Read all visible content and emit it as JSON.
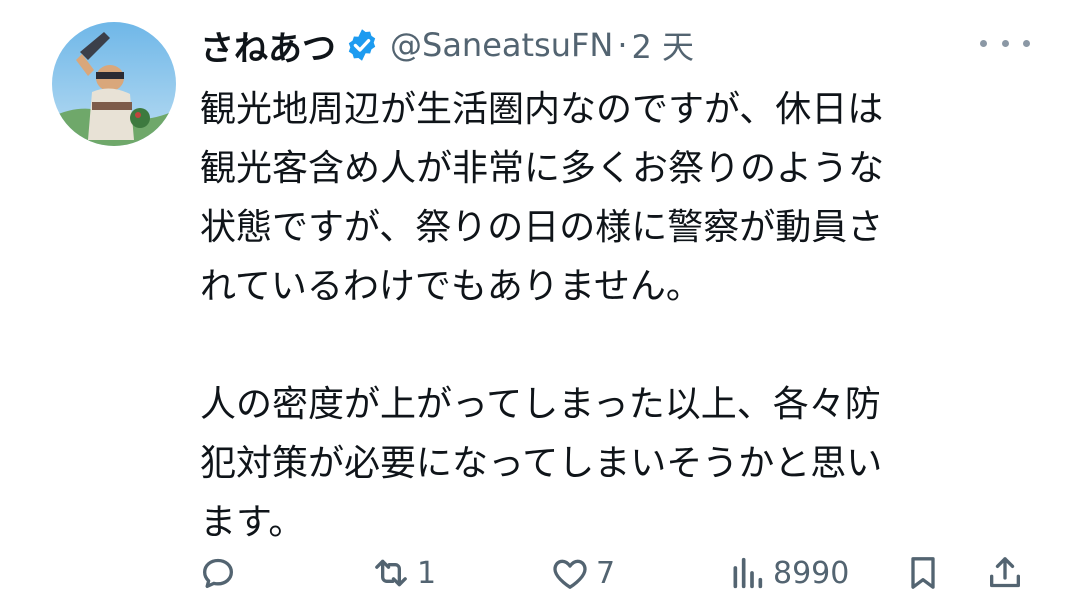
{
  "tweet": {
    "author": {
      "display_name": "さねあつ",
      "handle": "@SaneatsuFN",
      "verified": true
    },
    "separator": "·",
    "timestamp": "2 天",
    "paragraphs": [
      "観光地周辺が生活圏内なのですが、休日は\n観光客含め人が非常に多くお祭りのような\n状態ですが、祭りの日の様に警察が動員さ\nれているわけでもありません。",
      "人の密度が上がってしまった以上、各々防\n犯対策が必要になってしまいそうかと思い\nます。"
    ]
  },
  "actions": {
    "reply_icon": "reply-icon",
    "retweet_icon": "retweet-icon",
    "retweet_count": "1",
    "like_icon": "heart-icon",
    "like_count": "7",
    "views_icon": "views-icon",
    "views_count": "8990",
    "bookmark_icon": "bookmark-icon",
    "share_icon": "share-icon"
  },
  "colors": {
    "text_primary": "#0f1419",
    "text_secondary": "#536471",
    "verified_blue": "#1d9bf0",
    "icon_gray": "#536471"
  }
}
